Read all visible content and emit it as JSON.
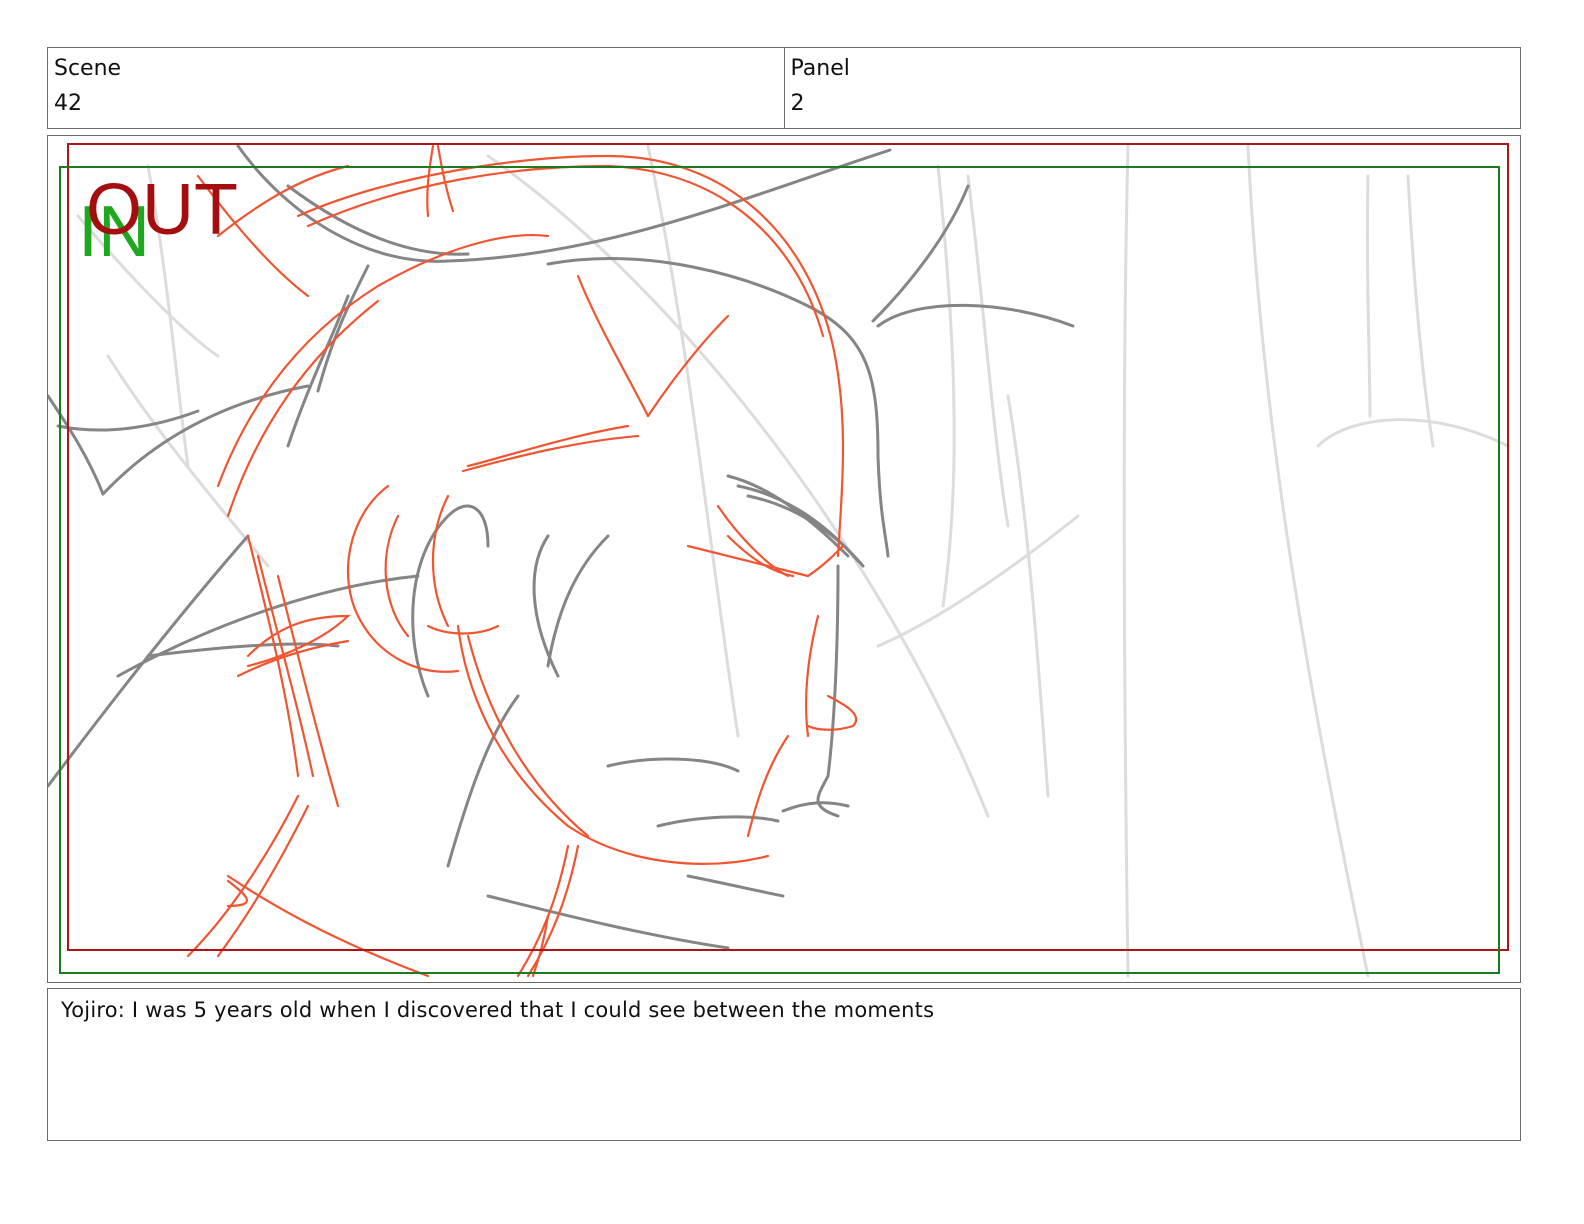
{
  "header": {
    "scene_label": "Scene",
    "scene_value": "42",
    "panel_label": "Panel",
    "panel_value": "2"
  },
  "panel": {
    "in_label": "IN",
    "out_label": "OUT",
    "in_frame_color": "#1e7a1e",
    "out_frame_color": "#b01010",
    "sketch_colors": {
      "construction": "#f05030",
      "line": "#7c7c7c",
      "light": "#d9d9d9"
    }
  },
  "caption": {
    "text": "Yojiro: I was 5 years old when I discovered that I could see between the moments"
  }
}
